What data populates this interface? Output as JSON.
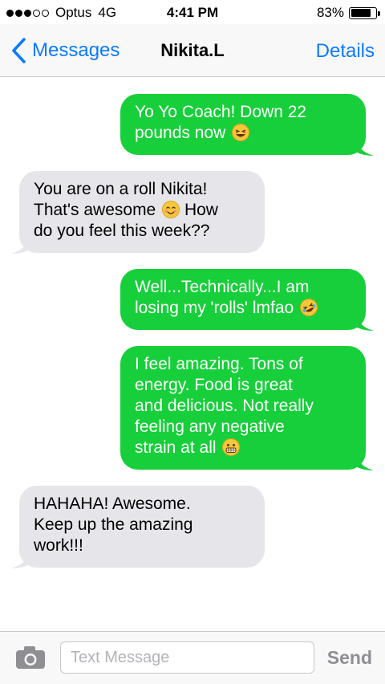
{
  "status_bar": {
    "carrier": "Optus",
    "network": "4G",
    "time": "4:41 PM",
    "battery_percent": "83%",
    "battery_level": 0.83,
    "signal_bars": 3,
    "signal_bars_max": 5
  },
  "nav": {
    "back_label": "Messages",
    "contact_name": "Nikita.L",
    "details_label": "Details"
  },
  "messages": [
    {
      "direction": "outgoing",
      "lines": [
        "Yo Yo Coach! Down 22",
        "pounds now"
      ],
      "emoji": "laughing-face-emoji"
    },
    {
      "direction": "incoming",
      "lines": [
        "You are on a roll Nikita!",
        "That's awesome",
        "How",
        "do you feel this week??"
      ],
      "emoji": "smiling-face-emoji"
    },
    {
      "direction": "outgoing",
      "lines": [
        "Well...Technically...I am",
        "losing my 'rolls' lmfao"
      ],
      "emoji": "rolling-on-floor-laughing-emoji"
    },
    {
      "direction": "outgoing",
      "lines": [
        "I feel amazing. Tons of",
        "energy. Food is great",
        "and delicious. Not really",
        "feeling any negative",
        "strain at all"
      ],
      "emoji": "grimacing-face-emoji"
    },
    {
      "direction": "incoming",
      "lines": [
        "HAHAHA! Awesome.",
        "Keep up the amazing",
        "work!!!"
      ],
      "emoji": null
    }
  ],
  "input_bar": {
    "camera_icon": "camera-icon",
    "placeholder": "Text Message",
    "send_label": "Send"
  },
  "colors": {
    "outgoing_bubble": "#17cf3a",
    "incoming_bubble": "#e5e5ea",
    "ios_blue": "#0a7aff",
    "send_disabled": "#8e8e93"
  }
}
